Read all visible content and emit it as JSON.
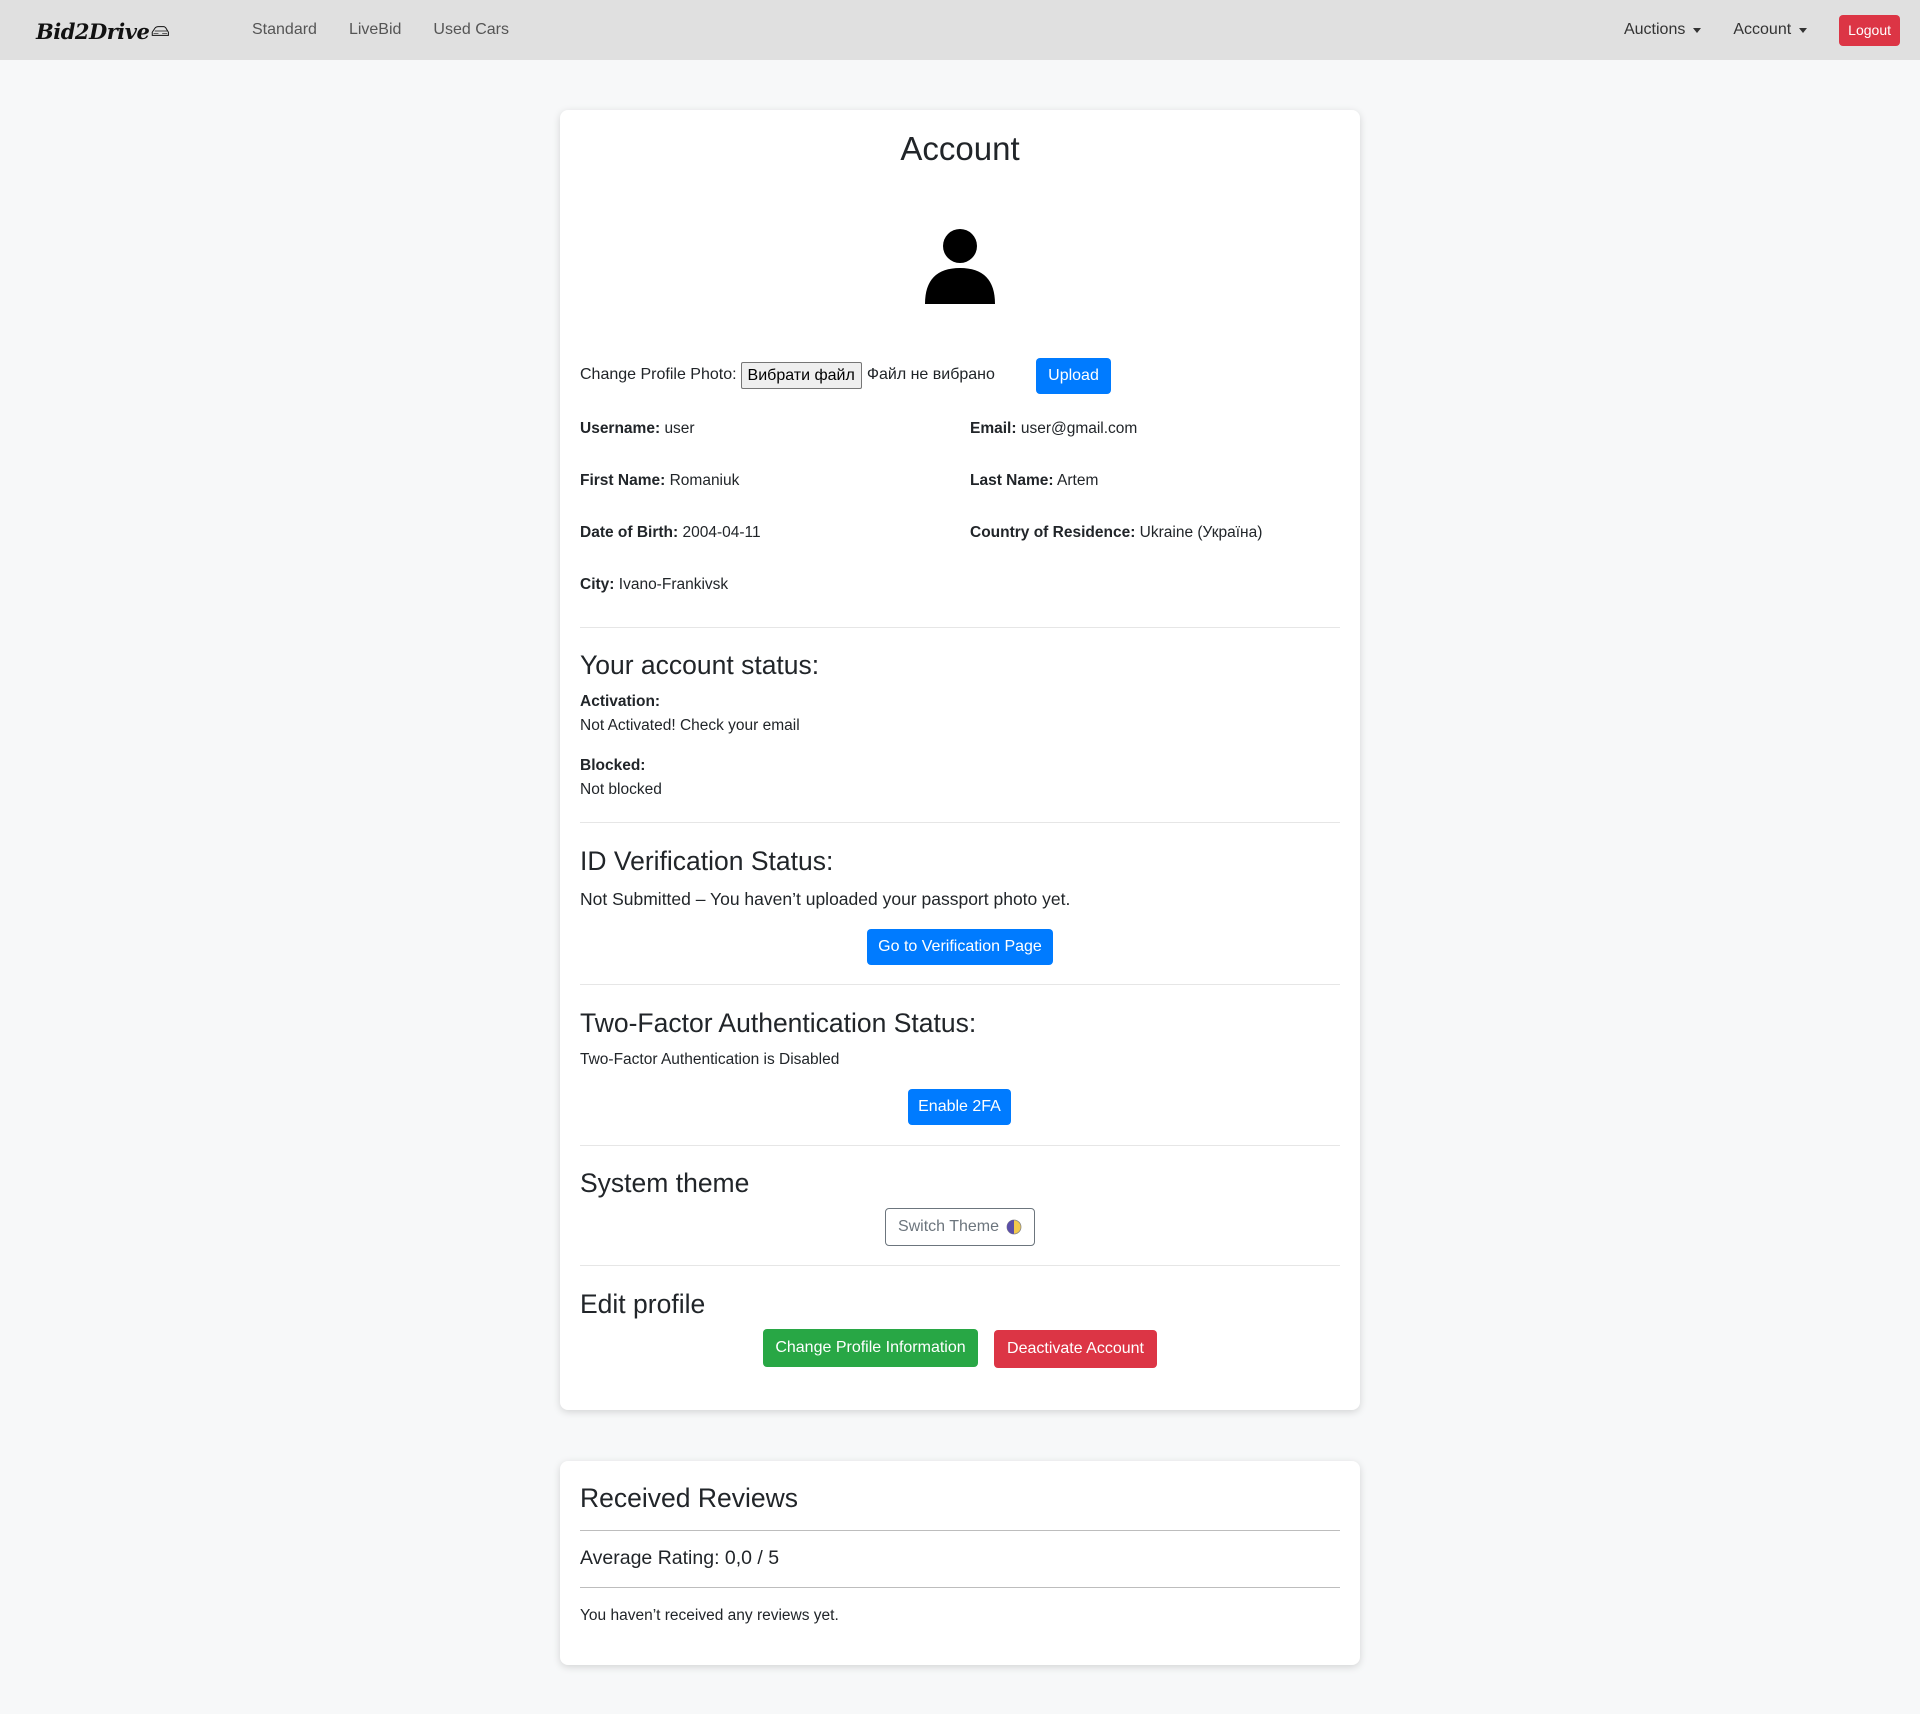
{
  "navbar": {
    "brand": "Bid2Drive",
    "links": [
      "Standard",
      "LiveBid",
      "Used Cars"
    ],
    "auctions_label": "Auctions",
    "account_label": "Account",
    "logout_label": "Logout"
  },
  "account": {
    "title": "Account",
    "photo": {
      "label": "Change Profile Photo:",
      "choose_file": "Вибрати файл",
      "no_file": "Файл не вибрано",
      "upload": "Upload"
    },
    "fields": {
      "username_label": "Username:",
      "username": "user",
      "email_label": "Email:",
      "email": "user@gmail.com",
      "first_name_label": "First Name:",
      "first_name": "Romaniuk",
      "last_name_label": "Last Name:",
      "last_name": "Artem",
      "dob_label": "Date of Birth:",
      "dob": "2004-04-11",
      "country_label": "Country of Residence:",
      "country": "Ukraine (Україна)",
      "city_label": "City:",
      "city": "Ivano-Frankivsk"
    },
    "status": {
      "heading": "Your account status:",
      "activation_label": "Activation:",
      "activation_value": "Not Activated! Check your email",
      "blocked_label": "Blocked:",
      "blocked_value": "Not blocked"
    },
    "id_verification": {
      "heading": "ID Verification Status:",
      "text": "Not Submitted – You haven’t uploaded your passport photo yet.",
      "button": "Go to Verification Page"
    },
    "two_factor": {
      "heading": "Two-Factor Authentication Status:",
      "text": "Two-Factor Authentication is Disabled",
      "button": "Enable 2FA"
    },
    "theme": {
      "heading": "System theme",
      "button": "Switch Theme"
    },
    "edit": {
      "heading": "Edit profile",
      "change_button": "Change Profile Information",
      "deactivate_button": "Deactivate Account"
    }
  },
  "reviews": {
    "title": "Received Reviews",
    "average": "Average Rating: 0,0 / 5",
    "empty": "You haven’t received any reviews yet."
  },
  "colors": {
    "primary": "#007bff",
    "success": "#28a745",
    "danger": "#dc3545",
    "navbar_bg": "#e0e0e0"
  }
}
